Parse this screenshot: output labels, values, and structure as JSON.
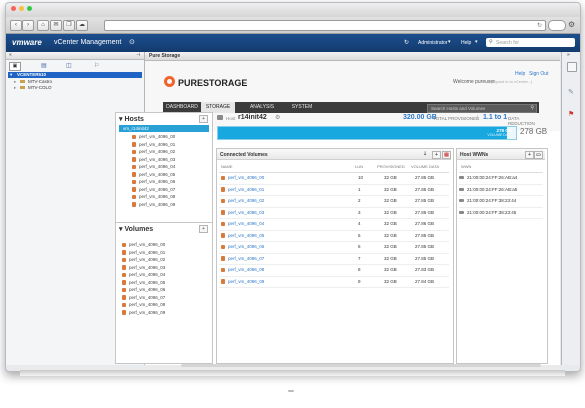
{
  "vcenter": {
    "logo": "vmware",
    "title": "vCenter Management",
    "user": "Administrator",
    "help": "Help",
    "search_placeholder": "Search for"
  },
  "tree": {
    "root": "VCENTER510",
    "children": [
      "MTV-Castro",
      "MTV-COLO"
    ]
  },
  "main_tab": "Pure Storage",
  "purestorage": {
    "logo": "PURESTORAGE",
    "help": "Help",
    "sign_out": "Sign Out",
    "welcome": "Welcome pureuser",
    "welcome_sub": "(signed in to vCenter...)",
    "tabs": [
      "DASHBOARD",
      "STORAGE",
      "ANALYSIS",
      "SYSTEM"
    ],
    "active_tab": "STORAGE",
    "search_placeholder": "Search Hosts and Volumes"
  },
  "hosts": {
    "title": "Hosts",
    "group": "vm_r14init42",
    "items": [
      "perf_vm_4096_00",
      "perf_vm_4096_01",
      "perf_vm_4096_02",
      "perf_vm_4096_03",
      "perf_vm_4096_04",
      "perf_vm_4096_05",
      "perf_vm_4096_06",
      "perf_vm_4096_07",
      "perf_vm_4096_08",
      "perf_vm_4096_09"
    ]
  },
  "volumes": {
    "title": "Volumes",
    "items": [
      "perf_vm_4096_00",
      "perf_vm_4096_01",
      "perf_vm_4096_02",
      "perf_vm_4096_03",
      "perf_vm_4096_04",
      "perf_vm_4096_05",
      "perf_vm_4096_06",
      "perf_vm_4096_07",
      "perf_vm_4096_08",
      "perf_vm_4096_09"
    ]
  },
  "host_detail": {
    "prefix": "Host",
    "name": "r14init42",
    "provisioned": "320.00 GB",
    "provisioned_label": "TOTAL PROVISIONED",
    "reduction_value": "1.1 to 1",
    "reduction_label": "DATA REDUCTION",
    "bar_label": "278 GB",
    "bar_sublabel": "VOLUME DATA",
    "volume_data": "278 GB",
    "bar_fill": 0.97
  },
  "connected": {
    "title": "Connected Volumes",
    "columns": [
      "NAME",
      "LUN",
      "PROVISIONED",
      "VOLUME DATA"
    ],
    "rows": [
      {
        "name": "perf_vm_4096_00",
        "lun": "10",
        "prov": "32 GB",
        "data": "27.85 GB"
      },
      {
        "name": "perf_vm_4096_01",
        "lun": "1",
        "prov": "32 GB",
        "data": "27.85 GB"
      },
      {
        "name": "perf_vm_4096_02",
        "lun": "2",
        "prov": "32 GB",
        "data": "27.85 GB"
      },
      {
        "name": "perf_vm_4096_03",
        "lun": "3",
        "prov": "32 GB",
        "data": "27.85 GB"
      },
      {
        "name": "perf_vm_4096_04",
        "lun": "4",
        "prov": "32 GB",
        "data": "27.86 GB"
      },
      {
        "name": "perf_vm_4096_05",
        "lun": "5",
        "prov": "32 GB",
        "data": "27.85 GB"
      },
      {
        "name": "perf_vm_4096_06",
        "lun": "6",
        "prov": "32 GB",
        "data": "27.85 GB"
      },
      {
        "name": "perf_vm_4096_07",
        "lun": "7",
        "prov": "32 GB",
        "data": "27.85 GB"
      },
      {
        "name": "perf_vm_4096_08",
        "lun": "8",
        "prov": "32 GB",
        "data": "27.83 GB"
      },
      {
        "name": "perf_vm_4096_09",
        "lun": "9",
        "prov": "32 GB",
        "data": "27.84 GB"
      }
    ]
  },
  "wwns": {
    "title": "Host WWNs",
    "column": "WWN",
    "items": [
      "21:00:00:24:FF:26:AB:a4",
      "21:00:00:24:FF:26:AB:a5",
      "21:00:00:24:FF:38:23:44",
      "21:00:00:24:FF:38:23:45"
    ]
  },
  "colors": {
    "accent": "#2c76c8",
    "capacity_bar": "#17a8e0",
    "vmware_header": "#1d4f8e",
    "brand_orange": "#f0642a"
  }
}
